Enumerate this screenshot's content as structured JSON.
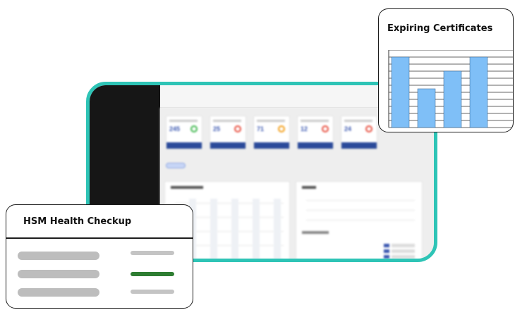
{
  "cert_card": {
    "title": "Expiring Certificates"
  },
  "chart_data": {
    "type": "bar",
    "title": "Expiring Certificates",
    "categories": [
      "",
      "",
      "",
      ""
    ],
    "values": [
      10,
      5.5,
      8,
      10
    ],
    "ylim": [
      0,
      11
    ],
    "grid": true,
    "bar_color": "#7fbff7"
  },
  "hsm_card": {
    "title": "HSM Health Checkup",
    "rows": [
      {
        "status": "neutral"
      },
      {
        "status": "healthy"
      },
      {
        "status": "neutral"
      }
    ],
    "status_colors": {
      "neutral": "#c4c4c4",
      "healthy": "#2e7d32"
    }
  },
  "background_app": {
    "accent_color": "#2ec4b6",
    "stat_cards": [
      {
        "value": "245",
        "indicator_color": "#3bb54a"
      },
      {
        "value": "25",
        "indicator_color": "#e74c3c"
      },
      {
        "value": "71",
        "indicator_color": "#f39c12"
      },
      {
        "value": "12",
        "indicator_color": "#e74c3c"
      },
      {
        "value": "24",
        "indicator_color": "#e74c3c"
      }
    ]
  }
}
